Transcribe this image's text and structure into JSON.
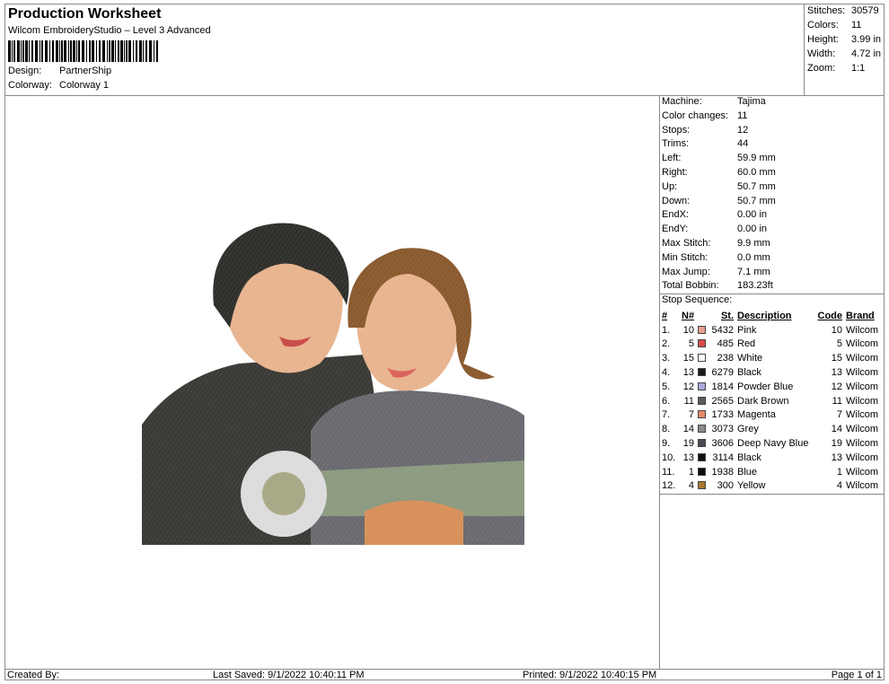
{
  "header": {
    "title": "Production Worksheet",
    "subtitle": "Wilcom EmbroideryStudio – Level 3 Advanced",
    "design_label": "Design:",
    "design_value": "PartnerShip",
    "colorway_label": "Colorway:",
    "colorway_value": "Colorway 1"
  },
  "stats": {
    "stitches_label": "Stitches:",
    "stitches": "30579",
    "colors_label": "Colors:",
    "colors": "11",
    "height_label": "Height:",
    "height": "3.99 in",
    "width_label": "Width:",
    "width": "4.72 in",
    "zoom_label": "Zoom:",
    "zoom": "1:1"
  },
  "machine_info": [
    {
      "k": "Machine:",
      "v": "Tajima"
    },
    {
      "k": "Color changes:",
      "v": "11"
    },
    {
      "k": "Stops:",
      "v": "12"
    },
    {
      "k": "Trims:",
      "v": "44"
    },
    {
      "k": "Left:",
      "v": "59.9 mm"
    },
    {
      "k": "Right:",
      "v": "60.0 mm"
    },
    {
      "k": "Up:",
      "v": "50.7 mm"
    },
    {
      "k": "Down:",
      "v": "50.7 mm"
    },
    {
      "k": "EndX:",
      "v": "0.00 in"
    },
    {
      "k": "EndY:",
      "v": "0.00 in"
    },
    {
      "k": "Max Stitch:",
      "v": "9.9 mm"
    },
    {
      "k": "Min Stitch:",
      "v": "0.0 mm"
    },
    {
      "k": "Max Jump:",
      "v": "7.1 mm"
    },
    {
      "k": "Total Bobbin:",
      "v": "183.23ft"
    }
  ],
  "stop_sequence": {
    "title": "Stop Sequence:",
    "headers": {
      "num": "#",
      "n": "N#",
      "st": "St.",
      "desc": "Description",
      "code": "Code",
      "brand": "Brand"
    },
    "rows": [
      {
        "idx": "1.",
        "n": "10",
        "color": "#e8a08e",
        "st": "5432",
        "desc": "Pink",
        "code": "10",
        "brand": "Wilcom"
      },
      {
        "idx": "2.",
        "n": "5",
        "color": "#d94b4b",
        "st": "485",
        "desc": "Red",
        "code": "5",
        "brand": "Wilcom"
      },
      {
        "idx": "3.",
        "n": "15",
        "color": "#ffffff",
        "st": "238",
        "desc": "White",
        "code": "15",
        "brand": "Wilcom"
      },
      {
        "idx": "4.",
        "n": "13",
        "color": "#1a1a1a",
        "st": "6279",
        "desc": "Black",
        "code": "13",
        "brand": "Wilcom"
      },
      {
        "idx": "5.",
        "n": "12",
        "color": "#a9a9d8",
        "st": "1814",
        "desc": "Powder Blue",
        "code": "12",
        "brand": "Wilcom"
      },
      {
        "idx": "6.",
        "n": "11",
        "color": "#5a5a5a",
        "st": "2565",
        "desc": "Dark Brown",
        "code": "11",
        "brand": "Wilcom"
      },
      {
        "idx": "7.",
        "n": "7",
        "color": "#e88a6a",
        "st": "1733",
        "desc": "Magenta",
        "code": "7",
        "brand": "Wilcom"
      },
      {
        "idx": "8.",
        "n": "14",
        "color": "#8a8a8a",
        "st": "3073",
        "desc": "Grey",
        "code": "14",
        "brand": "Wilcom"
      },
      {
        "idx": "9.",
        "n": "19",
        "color": "#4a4a52",
        "st": "3606",
        "desc": "Deep Navy Blue",
        "code": "19",
        "brand": "Wilcom"
      },
      {
        "idx": "10.",
        "n": "13",
        "color": "#111111",
        "st": "3114",
        "desc": "Black",
        "code": "13",
        "brand": "Wilcom"
      },
      {
        "idx": "11.",
        "n": "1",
        "color": "#0d0d0d",
        "st": "1938",
        "desc": "Blue",
        "code": "1",
        "brand": "Wilcom"
      },
      {
        "idx": "12.",
        "n": "4",
        "color": "#a8782e",
        "st": "300",
        "desc": "Yellow",
        "code": "4",
        "brand": "Wilcom"
      }
    ]
  },
  "footer": {
    "created_by": "Created By:",
    "last_saved": "Last Saved: 9/1/2022 10:40:11 PM",
    "printed": "Printed: 9/1/2022 10:40:15 PM",
    "page": "Page 1 of 1"
  }
}
